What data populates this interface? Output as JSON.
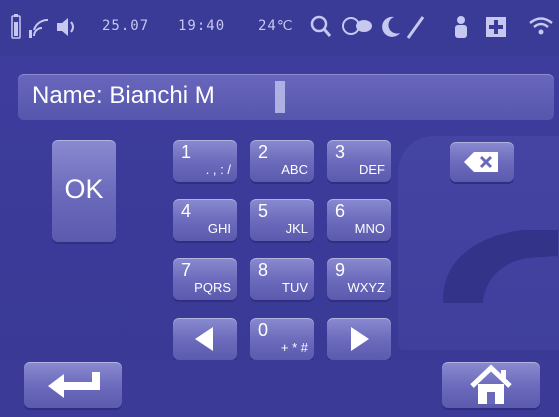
{
  "status_bar": {
    "date": "25.07",
    "time": "19:40",
    "temperature": "24℃",
    "icons": [
      "battery-icon",
      "signal-icon",
      "speaker-icon",
      "search-icon",
      "chat-icon",
      "moon-icon",
      "pen-icon",
      "person-icon",
      "medical-cross-icon",
      "wifi-icon"
    ]
  },
  "name_field": {
    "value": "Name: Bianchi M"
  },
  "keypad": {
    "ok_label": "OK",
    "keys": [
      {
        "num": "1",
        "sub": ". , : /"
      },
      {
        "num": "2",
        "sub": "ABC"
      },
      {
        "num": "3",
        "sub": "DEF"
      },
      {
        "num": "4",
        "sub": "GHI"
      },
      {
        "num": "5",
        "sub": "JKL"
      },
      {
        "num": "6",
        "sub": "MNO"
      },
      {
        "num": "7",
        "sub": "PQRS"
      },
      {
        "num": "8",
        "sub": "TUV"
      },
      {
        "num": "9",
        "sub": "WXYZ"
      },
      {
        "num": "0",
        "sub": "+ * #"
      }
    ]
  },
  "colors": {
    "background": "#3d3c9a",
    "key_face": "#6a69bb",
    "field": "#5f5eb4",
    "text": "#ffffff"
  }
}
